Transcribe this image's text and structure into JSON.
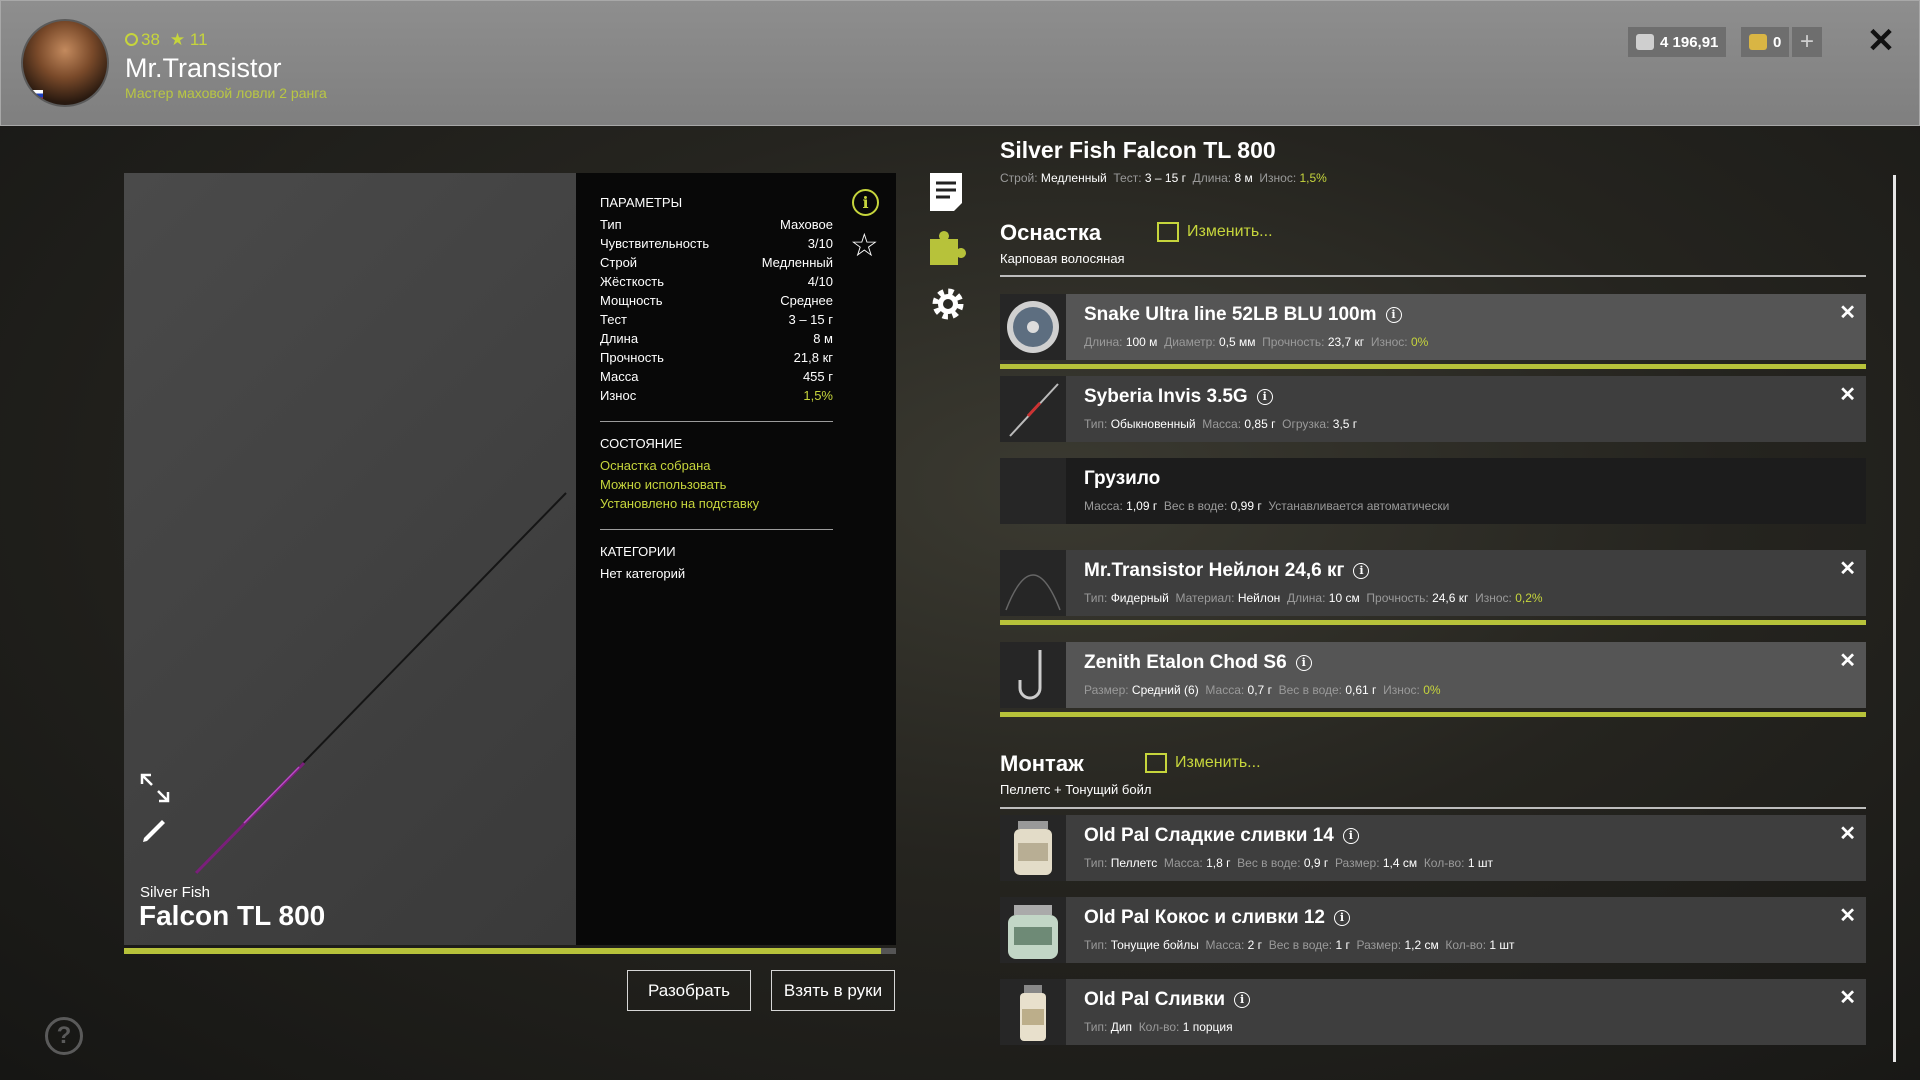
{
  "header": {
    "level": "38",
    "stars": "11",
    "username": "Mr.Transistor",
    "rank": "Мастер маховой ловли 2 ранга",
    "silver": "4 196,91",
    "gold": "0",
    "plus": "+",
    "close": "✕"
  },
  "preview": {
    "brand": "Silver Fish",
    "model": "Falcon TL 800",
    "progress": 0.98
  },
  "params": {
    "title": "ПАРАМЕТРЫ",
    "rows": [
      {
        "label": "Тип",
        "value": "Маховое"
      },
      {
        "label": "Чувствительность",
        "value": "3/10"
      },
      {
        "label": "Строй",
        "value": "Медленный"
      },
      {
        "label": "Жёсткость",
        "value": "4/10"
      },
      {
        "label": "Мощность",
        "value": "Среднее"
      },
      {
        "label": "Тест",
        "value": "3 – 15 г"
      },
      {
        "label": "Длина",
        "value": "8 м"
      },
      {
        "label": "Прочность",
        "value": "21,8 кг"
      },
      {
        "label": "Масса",
        "value": "455 г"
      },
      {
        "label": "Износ",
        "value": "1,5%"
      }
    ],
    "state_title": "СОСТОЯНИЕ",
    "state": [
      "Оснастка собрана",
      "Можно использовать",
      "Установлено на подставку"
    ],
    "cat_title": "КАТЕГОРИИ",
    "cat_value": "Нет категорий"
  },
  "buttons": {
    "disassemble": "Разобрать",
    "take": "Взять в руки"
  },
  "rod": {
    "title": "Silver Fish Falcon TL 800",
    "stroy_label": "Строй:",
    "stroy": "Медленный",
    "test_label": "Тест:",
    "test": "3 – 15 г",
    "length_label": "Длина:",
    "length": "8 м",
    "wear_label": "Износ:",
    "wear": "1,5%"
  },
  "rig": {
    "title": "Оснастка",
    "edit": "Изменить...",
    "subtitle": "Карповая волосяная",
    "items": [
      {
        "name": "Snake Ultra line 52LB BLU 100m",
        "meta": [
          [
            "Длина:",
            "100 м"
          ],
          [
            "Диаметр:",
            "0,5 мм"
          ],
          [
            "Прочность:",
            "23,7 кг"
          ],
          [
            "Износ:",
            "0%"
          ]
        ]
      },
      {
        "name": "Syberia Invis 3.5G",
        "meta": [
          [
            "Тип:",
            "Обыкновенный"
          ],
          [
            "Масса:",
            "0,85 г"
          ],
          [
            "Огрузка:",
            "3,5 г"
          ]
        ]
      },
      {
        "name": "Грузило",
        "meta": [
          [
            "Масса:",
            "1,09 г"
          ],
          [
            "Вес в воде:",
            "0,99 г"
          ],
          [
            "",
            "Устанавливается автоматически"
          ]
        ]
      },
      {
        "name": "Mr.Transistor Нейлон 24,6 кг",
        "meta": [
          [
            "Тип:",
            "Фидерный"
          ],
          [
            "Материал:",
            "Нейлон"
          ],
          [
            "Длина:",
            "10 см"
          ],
          [
            "Прочность:",
            "24,6 кг"
          ],
          [
            "Износ:",
            "0,2%"
          ]
        ]
      },
      {
        "name": "Zenith Etalon Chod S6",
        "meta": [
          [
            "Размер:",
            "Средний (6)"
          ],
          [
            "Масса:",
            "0,7 г"
          ],
          [
            "Вес в воде:",
            "0,61 г"
          ],
          [
            "Износ:",
            "0%"
          ]
        ]
      }
    ]
  },
  "mount": {
    "title": "Монтаж",
    "edit": "Изменить...",
    "subtitle": "Пеллетс + Тонущий бойл",
    "items": [
      {
        "name": "Old Pal Сладкие сливки 14",
        "meta": [
          [
            "Тип:",
            "Пеллетс"
          ],
          [
            "Масса:",
            "1,8 г"
          ],
          [
            "Вес в воде:",
            "0,9 г"
          ],
          [
            "Размер:",
            "1,4 см"
          ],
          [
            "Кол-во:",
            "1 шт"
          ]
        ]
      },
      {
        "name": "Old Pal Кокос и сливки 12",
        "meta": [
          [
            "Тип:",
            "Тонущие бойлы"
          ],
          [
            "Масса:",
            "2 г"
          ],
          [
            "Вес в воде:",
            "1 г"
          ],
          [
            "Размер:",
            "1,2 см"
          ],
          [
            "Кол-во:",
            "1 шт"
          ]
        ]
      },
      {
        "name": "Old Pal Сливки",
        "meta": [
          [
            "Тип:",
            "Дип"
          ],
          [
            "Кол-во:",
            "1 порция"
          ]
        ]
      }
    ]
  },
  "colors": {
    "accent": "#c6d53c",
    "bar": "#b7c23a"
  },
  "help": "?"
}
